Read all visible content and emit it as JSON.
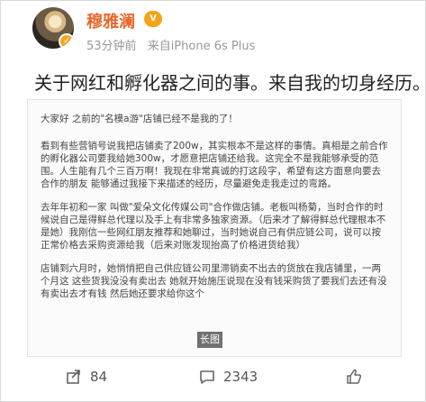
{
  "header": {
    "username": "穆雅澜",
    "vip_badge": "V",
    "time": "53分钟前",
    "source": "来自iPhone 6s Plus"
  },
  "post": {
    "headline": "关于网红和孵化器之间的事。来自我的切身经历。",
    "card": {
      "greeting": "大家好 之前的\"名模a游\"店铺已经不是我的了！",
      "para1": "看到有些营销号说我把店铺卖了200w，其实根本不是这样的事情。真相是之前合作的孵化器公司要我给她300w，才愿意把店铺还给我。这完全不是我能够承受的范围。人生能有几个三百万啊！我现在非常真诚的打这段字，希望有这方面意向要去合作的朋友 能够通过我接下来描述的经历，尽量避免走我走过的弯路。",
      "para2": "去年年初和一家 叫做\"爱朵文化传媒公司\"合作做店铺。老板叫杨菊，当时合作的时候说自己是得鲜总代理以及手上有非常多独家资源。（后来才了解得鲜总代理根本不是她）我刚信一些网红朋友推荐和她聊过，当时她说自己有供应链公司，说可以按正常价格去采购资源给我（后来对账发现抬高了价格进货给我）",
      "para3": "店铺到六月时，她悄悄把自己供应链公司里滞销卖不出去的货放在我店铺里，一两个月这 这些货我没没有卖出去 她就开始施压说现在没有钱采购货了要我们去还有没有卖出去才有钱 然后她还要求给你这个"
    },
    "long_image_tag": "长图"
  },
  "actions": {
    "share_count": "84",
    "comment_count": "2343",
    "like_count": ""
  },
  "colors": {
    "username": "#e8672a",
    "vip": "#f7a21b"
  }
}
